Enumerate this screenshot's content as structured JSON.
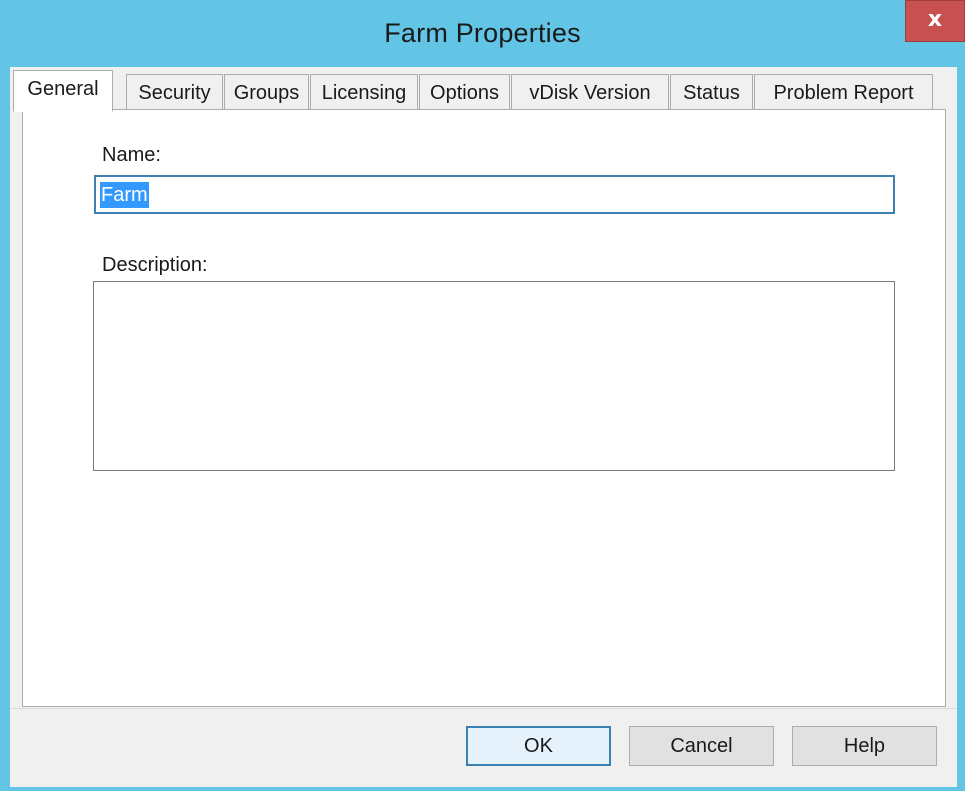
{
  "window": {
    "title": "Farm Properties",
    "close_glyph": "x"
  },
  "tabs": [
    {
      "label": "General",
      "selected": true
    },
    {
      "label": "Security",
      "selected": false
    },
    {
      "label": "Groups",
      "selected": false
    },
    {
      "label": "Licensing",
      "selected": false
    },
    {
      "label": "Options",
      "selected": false
    },
    {
      "label": "vDisk Version",
      "selected": false
    },
    {
      "label": "Status",
      "selected": false
    },
    {
      "label": "Problem Report",
      "selected": false
    }
  ],
  "general": {
    "name_label": "Name:",
    "name_value": "Farm",
    "description_label": "Description:",
    "description_value": ""
  },
  "buttons": {
    "ok": "OK",
    "cancel": "Cancel",
    "help": "Help"
  },
  "colors": {
    "titlebar": "#62c5e6",
    "close_button": "#c75050",
    "selection": "#3399ff",
    "focus_border": "#3c7fb1"
  }
}
